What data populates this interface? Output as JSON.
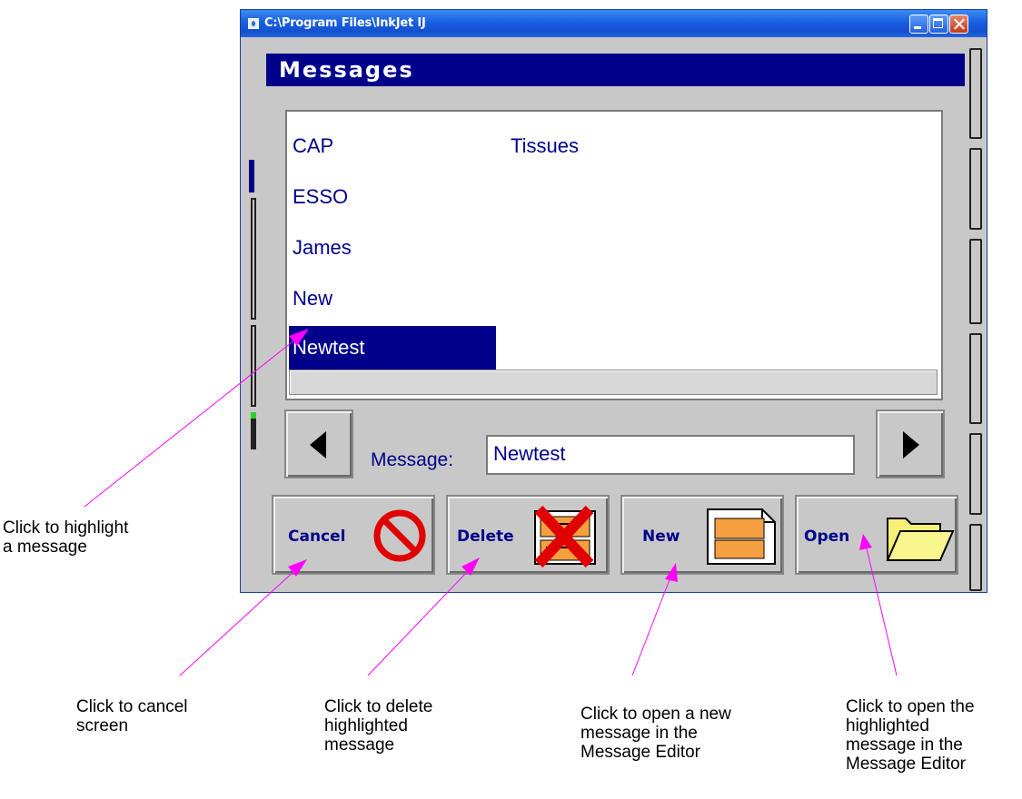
{
  "window": {
    "title": "C:\\Program Files\\InkJet   IJ"
  },
  "header": {
    "title": "Messages"
  },
  "list": {
    "items": [
      "CAP",
      "ESSO",
      "James",
      "New",
      "Newtest",
      "Tissues"
    ],
    "selected": "Newtest"
  },
  "message_field": {
    "label": "Message:",
    "value": "Newtest"
  },
  "buttons": {
    "cancel": "Cancel",
    "delete": "Delete",
    "new": "New",
    "open": "Open"
  },
  "annotations": {
    "highlight": [
      "Click to highlight",
      "a message"
    ],
    "cancel": [
      "Click to cancel",
      "screen"
    ],
    "delete": [
      "Click to delete",
      "highlighted",
      "message"
    ],
    "new": [
      "Click to open a new",
      "message in the",
      "Message Editor"
    ],
    "open": [
      "Click to open the",
      "highlighted",
      "message in the",
      "Message Editor"
    ]
  },
  "colors": {
    "title_blue": "#1a5fe0",
    "header_navy": "#00008b",
    "arrow_magenta": "#ff00ff",
    "cancel_red": "#e00000",
    "folder_yellow": "#f6f07a",
    "doc_orange": "#f4a040"
  }
}
